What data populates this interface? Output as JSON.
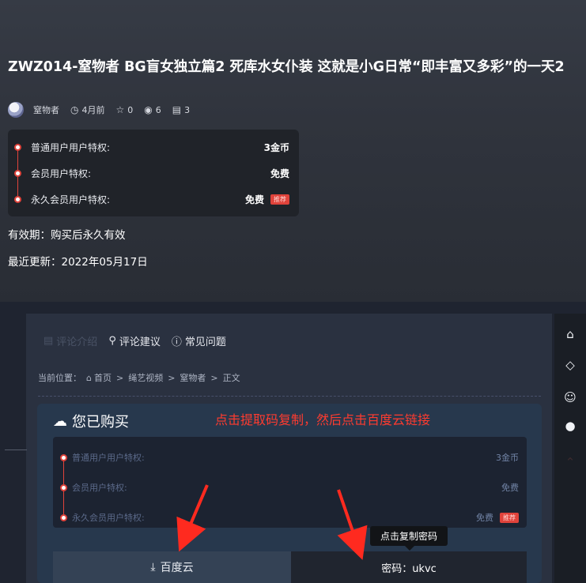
{
  "post": {
    "title": "ZWZ014-窒物者 BG盲女独立篇2 死库水女仆装 这就是小G日常“即丰富又多彩”的一天2",
    "meta": {
      "author": "窒物者",
      "time": "4月前",
      "favorites": "0",
      "views": "6",
      "comments": "3"
    },
    "prices": [
      {
        "label": "普通用户用户特权:",
        "value": "3金币"
      },
      {
        "label": "会员用户特权:",
        "value": "免费"
      },
      {
        "label": "永久会员用户特权:",
        "value": "免费",
        "tag": "推荐"
      }
    ],
    "validity": "有效期：购买后永久有效",
    "updated": "最近更新：2022年05月17日"
  },
  "content": {
    "tabs": [
      {
        "label": "评论介绍",
        "icon": "document-icon"
      },
      {
        "label": "评论建议",
        "icon": "chat-icon"
      },
      {
        "label": "常见问题",
        "icon": "question-icon"
      }
    ],
    "breadcrumb": {
      "prefix": "当前位置：",
      "home": "首页",
      "sep": ">",
      "cat1": "绳艺视频",
      "cat2": "窒物者",
      "current": "正文"
    },
    "purchased": {
      "title": "您已购买",
      "annotation": "点击提取码复制，然后点击百度云链接",
      "prices": [
        {
          "label": "普通用户用户特权:",
          "value": "3金币"
        },
        {
          "label": "会员用户特权:",
          "value": "免费"
        },
        {
          "label": "永久会员用户特权:",
          "value": "免费",
          "tag": "推荐"
        }
      ],
      "download_label": "百度云",
      "password_label": "密码：ukvc",
      "tooltip": "点击复制密码"
    }
  },
  "colors": {
    "accent_red": "#e0433b",
    "annotation_red": "#ff3b2f"
  }
}
